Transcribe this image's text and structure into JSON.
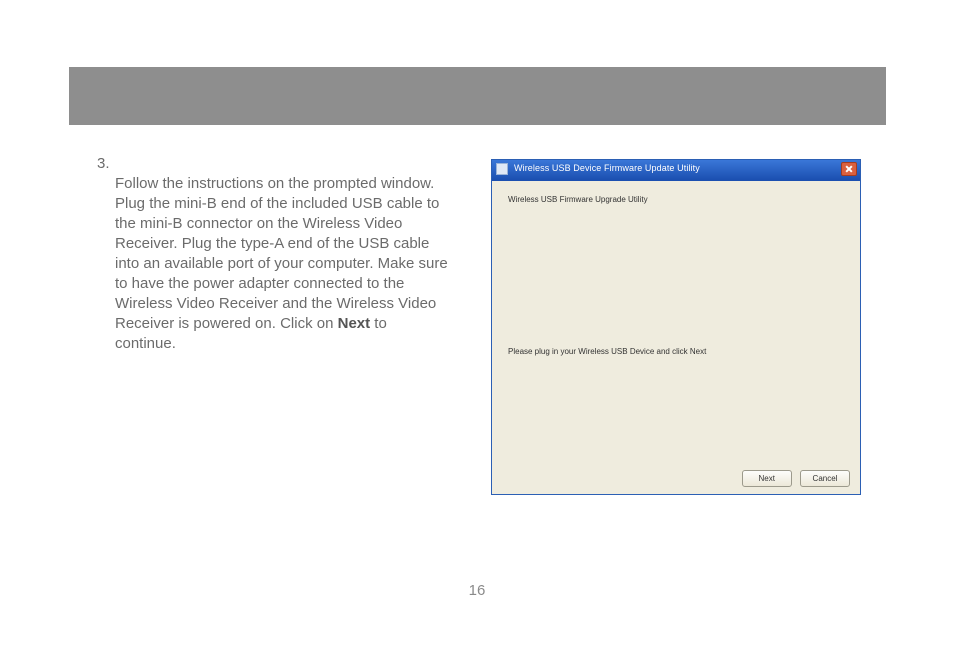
{
  "doc": {
    "step_number": "3.",
    "step_text_pre": "Follow the instructions on the prompted window.  Plug the mini-B end of the included USB cable to the mini-B connector on the Wireless Video Receiver.  Plug the type-A end of the USB cable into an available port of your computer.  Make sure to have the power adapter connected to the Wireless Video Receiver and the Wireless Video Receiver is powered on.  Click on ",
    "step_text_bold": "Next",
    "step_text_post": " to continue.",
    "page_number": "16"
  },
  "dialog": {
    "titlebar": "Wireless USB Device Firmware Update Utility",
    "heading": "Wireless USB Firmware Upgrade Utility",
    "message": "Please plug in your Wireless USB Device and click Next",
    "buttons": {
      "next": "Next",
      "cancel": "Cancel"
    }
  }
}
